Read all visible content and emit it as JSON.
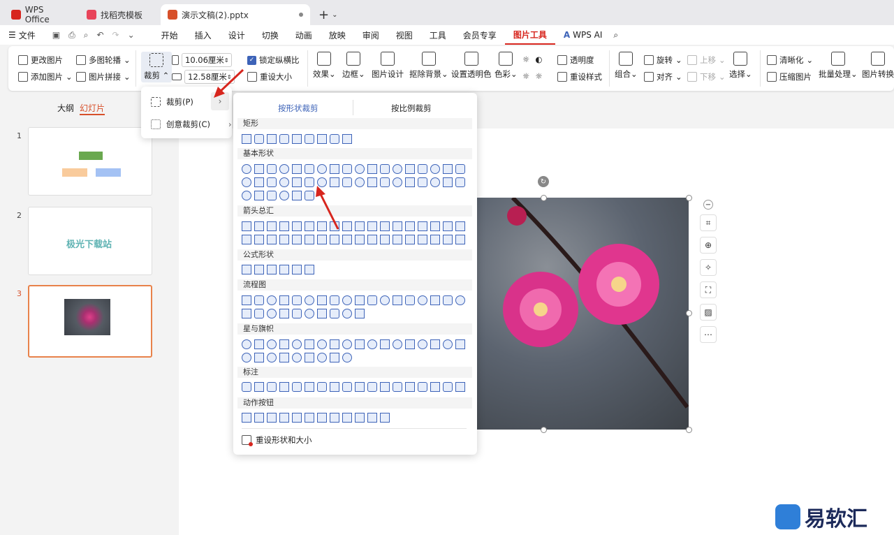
{
  "tabs": [
    {
      "label": "WPS Office",
      "color": "#d7261e"
    },
    {
      "label": "找稻壳模板",
      "color": "#e8445a"
    },
    {
      "label": "演示文稿(2).pptx",
      "color": "#d7502a"
    }
  ],
  "menu": {
    "file": "文件",
    "items": [
      "开始",
      "插入",
      "设计",
      "切换",
      "动画",
      "放映",
      "审阅",
      "视图",
      "工具",
      "会员专享",
      "图片工具"
    ],
    "wps_ai": "WPS AI"
  },
  "ribbon": {
    "change_pic": "更改图片",
    "add_pic": "添加图片",
    "multi_carousel": "多图轮播",
    "pic_collage": "图片拼接",
    "crop": "裁剪",
    "width": "10.06厘米",
    "height": "12.58厘米",
    "lock_ratio": "锁定纵横比",
    "reset_size": "重设大小",
    "effect": "效果",
    "border": "边框",
    "pic_design": "图片设计",
    "remove_bg": "抠除背景",
    "set_transparent": "设置透明色",
    "color": "色彩",
    "transparency": "透明度",
    "reset_style": "重设样式",
    "rotate": "旋转",
    "group": "组合",
    "align": "对齐",
    "up": "上移",
    "down": "下移",
    "select": "选择",
    "sharpen": "清晰化",
    "compress": "压缩图片",
    "batch": "批量处理",
    "convert": "图片转换"
  },
  "left_panel": {
    "outline": "大纲",
    "slides": "幻灯片",
    "slide_numbers": [
      "1",
      "2",
      "3"
    ],
    "slide2_text": "极光下载站"
  },
  "crop_menu": {
    "crop": "裁剪(P)",
    "creative_crop": "创意裁剪(C)"
  },
  "shape_panel": {
    "tab_shape": "按形状裁剪",
    "tab_ratio": "按比例裁剪",
    "categories": [
      "矩形",
      "基本形状",
      "箭头总汇",
      "公式形状",
      "流程图",
      "星与旗帜",
      "标注",
      "动作按钮"
    ],
    "reset": "重设形状和大小"
  },
  "brand": {
    "name": "易软汇"
  },
  "colors": {
    "accent": "#d7261e",
    "blue": "#3d63b8",
    "selection": "#e8824a"
  }
}
